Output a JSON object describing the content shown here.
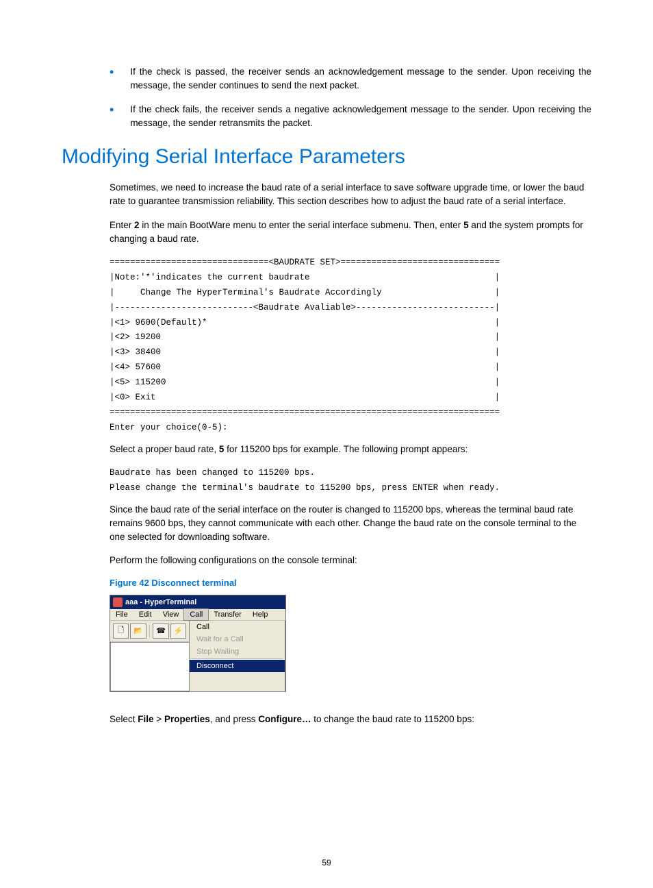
{
  "bullets": [
    "If the check is passed, the receiver sends an acknowledgement message to the sender. Upon receiving the message, the sender continues to send the next packet.",
    "If the check fails, the receiver sends a negative acknowledgement message to the sender. Upon receiving the message, the sender retransmits the packet."
  ],
  "heading": "Modifying Serial Interface Parameters",
  "para1": "Sometimes, we need to increase the baud rate of a serial interface to save software upgrade time, or lower the baud rate to guarantee transmission reliability. This section describes how to adjust the baud rate of a serial interface.",
  "para2_pre": "Enter ",
  "para2_b1": "2",
  "para2_mid": " in the main BootWare menu to enter the serial interface submenu. Then, enter ",
  "para2_b2": "5",
  "para2_post": " and the system prompts for changing a baud rate.",
  "terminal1": "===============================<BAUDRATE SET>===============================\n|Note:'*'indicates the current baudrate                                    |\n|     Change The HyperTerminal's Baudrate Accordingly                      |\n|---------------------------<Baudrate Avaliable>---------------------------|\n|<1> 9600(Default)*                                                        |\n|<2> 19200                                                                 |\n|<3> 38400                                                                 |\n|<4> 57600                                                                 |\n|<5> 115200                                                                |\n|<0> Exit                                                                  |\n============================================================================\nEnter your choice(0-5):",
  "para3_pre": "Select a proper baud rate, ",
  "para3_b1": "5",
  "para3_post": " for 115200 bps for example. The following prompt appears:",
  "terminal2": "Baudrate has been changed to 115200 bps.\nPlease change the terminal's baudrate to 115200 bps, press ENTER when ready.",
  "para4": "Since the baud rate of the serial interface on the router is changed to 115200 bps, whereas the terminal baud rate remains 9600 bps, they cannot communicate with each other. Change the baud rate on the console terminal to the one selected for downloading software.",
  "para5": "Perform the following configurations on the console terminal:",
  "figure_caption": "Figure 42 Disconnect terminal",
  "hyperterminal": {
    "title": "aaa - HyperTerminal",
    "menus": [
      "File",
      "Edit",
      "View",
      "Call",
      "Transfer",
      "Help"
    ],
    "dropdown": {
      "items": [
        {
          "label": "Call",
          "disabled": false,
          "selected": false
        },
        {
          "label": "Wait for a Call",
          "disabled": true,
          "selected": false
        },
        {
          "label": "Stop Waiting",
          "disabled": true,
          "selected": false
        },
        {
          "label": "Disconnect",
          "disabled": false,
          "selected": true
        }
      ]
    }
  },
  "para6_pre": "Select ",
  "para6_b1": "File",
  "para6_gt": " > ",
  "para6_b2": "Properties",
  "para6_mid": ", and press ",
  "para6_b3": "Configure…",
  "para6_post": " to change the baud rate to 115200 bps:",
  "page_number": "59"
}
